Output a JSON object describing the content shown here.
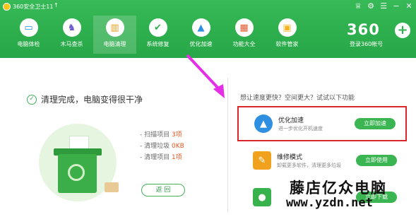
{
  "app": {
    "title": "360安全卫士11",
    "titlebar_icons": [
      "shirt-icon",
      "settings-icon",
      "menu-icon",
      "minimize-icon",
      "close-icon"
    ]
  },
  "nav": {
    "items": [
      {
        "label": "电脑体检",
        "icon": "monitor-icon",
        "color": "#2b8fd6"
      },
      {
        "label": "木马查杀",
        "icon": "horse-icon",
        "color": "#6a5acd"
      },
      {
        "label": "电脑清理",
        "icon": "broom-icon",
        "color": "#f29a1c",
        "active": true
      },
      {
        "label": "系统修复",
        "icon": "shield-icon",
        "color": "#2fae45"
      },
      {
        "label": "优化加速",
        "icon": "rocket-icon",
        "color": "#2f8fe0"
      },
      {
        "label": "功能大全",
        "icon": "grid-icon",
        "color": "#e8572c"
      },
      {
        "label": "软件管家",
        "icon": "apps-icon",
        "color": "#f2b325"
      }
    ]
  },
  "brand": {
    "logo_text": "360",
    "login_label": "登录360帐号"
  },
  "result": {
    "message": "清理完成，电脑变得很干净"
  },
  "stats": [
    {
      "label": "- 扫描项目",
      "value": "3项"
    },
    {
      "label": "- 清理垃圾",
      "value": "0KB"
    },
    {
      "label": "- 清理项目",
      "value": "1项"
    }
  ],
  "back_label": "返 回",
  "right_panel": {
    "header": "想让速度更快？空间更大？试试以下功能",
    "cards": [
      {
        "title": "优化加速",
        "desc": "进一步优化开机速度",
        "button": "立即加速",
        "icon": "rocket-icon",
        "icon_color": "#2f8fe0",
        "highlight": true
      },
      {
        "title": "维修模式",
        "desc": "卸载更多软件，清理更多垃圾",
        "button": "立即使用",
        "icon": "wrench-icon",
        "icon_color": "#f0a21f",
        "highlight": false
      },
      {
        "title": "",
        "desc": "",
        "button": "立即下载",
        "icon": "chat-icon",
        "icon_color": "#37b24d",
        "highlight": false
      }
    ]
  },
  "watermark": {
    "text": "藤店亿众电脑",
    "url": "www.yzdn.net"
  },
  "colors": {
    "header_green": "#2fb04f",
    "highlight_red": "#d9262a",
    "annotation_arrow": "#e62ee6",
    "stat_value": "#e8551c"
  }
}
